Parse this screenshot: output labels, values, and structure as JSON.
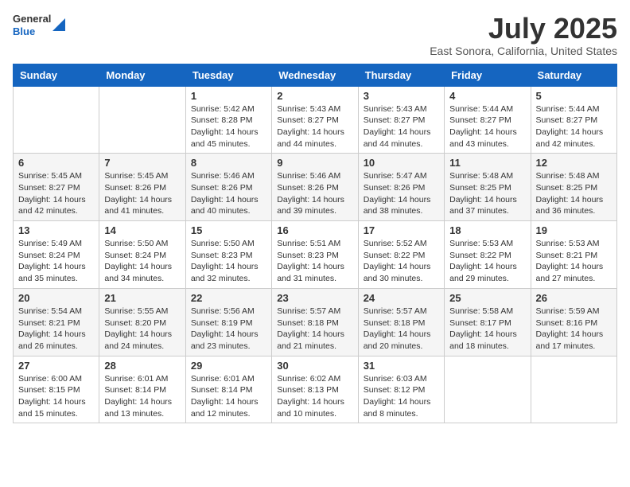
{
  "header": {
    "logo_general": "General",
    "logo_blue": "Blue",
    "title": "July 2025",
    "location": "East Sonora, California, United States"
  },
  "weekdays": [
    "Sunday",
    "Monday",
    "Tuesday",
    "Wednesday",
    "Thursday",
    "Friday",
    "Saturday"
  ],
  "weeks": [
    [
      {
        "day": "",
        "sunrise": "",
        "sunset": "",
        "daylight": ""
      },
      {
        "day": "",
        "sunrise": "",
        "sunset": "",
        "daylight": ""
      },
      {
        "day": "1",
        "sunrise": "Sunrise: 5:42 AM",
        "sunset": "Sunset: 8:28 PM",
        "daylight": "Daylight: 14 hours and 45 minutes."
      },
      {
        "day": "2",
        "sunrise": "Sunrise: 5:43 AM",
        "sunset": "Sunset: 8:27 PM",
        "daylight": "Daylight: 14 hours and 44 minutes."
      },
      {
        "day": "3",
        "sunrise": "Sunrise: 5:43 AM",
        "sunset": "Sunset: 8:27 PM",
        "daylight": "Daylight: 14 hours and 44 minutes."
      },
      {
        "day": "4",
        "sunrise": "Sunrise: 5:44 AM",
        "sunset": "Sunset: 8:27 PM",
        "daylight": "Daylight: 14 hours and 43 minutes."
      },
      {
        "day": "5",
        "sunrise": "Sunrise: 5:44 AM",
        "sunset": "Sunset: 8:27 PM",
        "daylight": "Daylight: 14 hours and 42 minutes."
      }
    ],
    [
      {
        "day": "6",
        "sunrise": "Sunrise: 5:45 AM",
        "sunset": "Sunset: 8:27 PM",
        "daylight": "Daylight: 14 hours and 42 minutes."
      },
      {
        "day": "7",
        "sunrise": "Sunrise: 5:45 AM",
        "sunset": "Sunset: 8:26 PM",
        "daylight": "Daylight: 14 hours and 41 minutes."
      },
      {
        "day": "8",
        "sunrise": "Sunrise: 5:46 AM",
        "sunset": "Sunset: 8:26 PM",
        "daylight": "Daylight: 14 hours and 40 minutes."
      },
      {
        "day": "9",
        "sunrise": "Sunrise: 5:46 AM",
        "sunset": "Sunset: 8:26 PM",
        "daylight": "Daylight: 14 hours and 39 minutes."
      },
      {
        "day": "10",
        "sunrise": "Sunrise: 5:47 AM",
        "sunset": "Sunset: 8:26 PM",
        "daylight": "Daylight: 14 hours and 38 minutes."
      },
      {
        "day": "11",
        "sunrise": "Sunrise: 5:48 AM",
        "sunset": "Sunset: 8:25 PM",
        "daylight": "Daylight: 14 hours and 37 minutes."
      },
      {
        "day": "12",
        "sunrise": "Sunrise: 5:48 AM",
        "sunset": "Sunset: 8:25 PM",
        "daylight": "Daylight: 14 hours and 36 minutes."
      }
    ],
    [
      {
        "day": "13",
        "sunrise": "Sunrise: 5:49 AM",
        "sunset": "Sunset: 8:24 PM",
        "daylight": "Daylight: 14 hours and 35 minutes."
      },
      {
        "day": "14",
        "sunrise": "Sunrise: 5:50 AM",
        "sunset": "Sunset: 8:24 PM",
        "daylight": "Daylight: 14 hours and 34 minutes."
      },
      {
        "day": "15",
        "sunrise": "Sunrise: 5:50 AM",
        "sunset": "Sunset: 8:23 PM",
        "daylight": "Daylight: 14 hours and 32 minutes."
      },
      {
        "day": "16",
        "sunrise": "Sunrise: 5:51 AM",
        "sunset": "Sunset: 8:23 PM",
        "daylight": "Daylight: 14 hours and 31 minutes."
      },
      {
        "day": "17",
        "sunrise": "Sunrise: 5:52 AM",
        "sunset": "Sunset: 8:22 PM",
        "daylight": "Daylight: 14 hours and 30 minutes."
      },
      {
        "day": "18",
        "sunrise": "Sunrise: 5:53 AM",
        "sunset": "Sunset: 8:22 PM",
        "daylight": "Daylight: 14 hours and 29 minutes."
      },
      {
        "day": "19",
        "sunrise": "Sunrise: 5:53 AM",
        "sunset": "Sunset: 8:21 PM",
        "daylight": "Daylight: 14 hours and 27 minutes."
      }
    ],
    [
      {
        "day": "20",
        "sunrise": "Sunrise: 5:54 AM",
        "sunset": "Sunset: 8:21 PM",
        "daylight": "Daylight: 14 hours and 26 minutes."
      },
      {
        "day": "21",
        "sunrise": "Sunrise: 5:55 AM",
        "sunset": "Sunset: 8:20 PM",
        "daylight": "Daylight: 14 hours and 24 minutes."
      },
      {
        "day": "22",
        "sunrise": "Sunrise: 5:56 AM",
        "sunset": "Sunset: 8:19 PM",
        "daylight": "Daylight: 14 hours and 23 minutes."
      },
      {
        "day": "23",
        "sunrise": "Sunrise: 5:57 AM",
        "sunset": "Sunset: 8:18 PM",
        "daylight": "Daylight: 14 hours and 21 minutes."
      },
      {
        "day": "24",
        "sunrise": "Sunrise: 5:57 AM",
        "sunset": "Sunset: 8:18 PM",
        "daylight": "Daylight: 14 hours and 20 minutes."
      },
      {
        "day": "25",
        "sunrise": "Sunrise: 5:58 AM",
        "sunset": "Sunset: 8:17 PM",
        "daylight": "Daylight: 14 hours and 18 minutes."
      },
      {
        "day": "26",
        "sunrise": "Sunrise: 5:59 AM",
        "sunset": "Sunset: 8:16 PM",
        "daylight": "Daylight: 14 hours and 17 minutes."
      }
    ],
    [
      {
        "day": "27",
        "sunrise": "Sunrise: 6:00 AM",
        "sunset": "Sunset: 8:15 PM",
        "daylight": "Daylight: 14 hours and 15 minutes."
      },
      {
        "day": "28",
        "sunrise": "Sunrise: 6:01 AM",
        "sunset": "Sunset: 8:14 PM",
        "daylight": "Daylight: 14 hours and 13 minutes."
      },
      {
        "day": "29",
        "sunrise": "Sunrise: 6:01 AM",
        "sunset": "Sunset: 8:14 PM",
        "daylight": "Daylight: 14 hours and 12 minutes."
      },
      {
        "day": "30",
        "sunrise": "Sunrise: 6:02 AM",
        "sunset": "Sunset: 8:13 PM",
        "daylight": "Daylight: 14 hours and 10 minutes."
      },
      {
        "day": "31",
        "sunrise": "Sunrise: 6:03 AM",
        "sunset": "Sunset: 8:12 PM",
        "daylight": "Daylight: 14 hours and 8 minutes."
      },
      {
        "day": "",
        "sunrise": "",
        "sunset": "",
        "daylight": ""
      },
      {
        "day": "",
        "sunrise": "",
        "sunset": "",
        "daylight": ""
      }
    ]
  ]
}
